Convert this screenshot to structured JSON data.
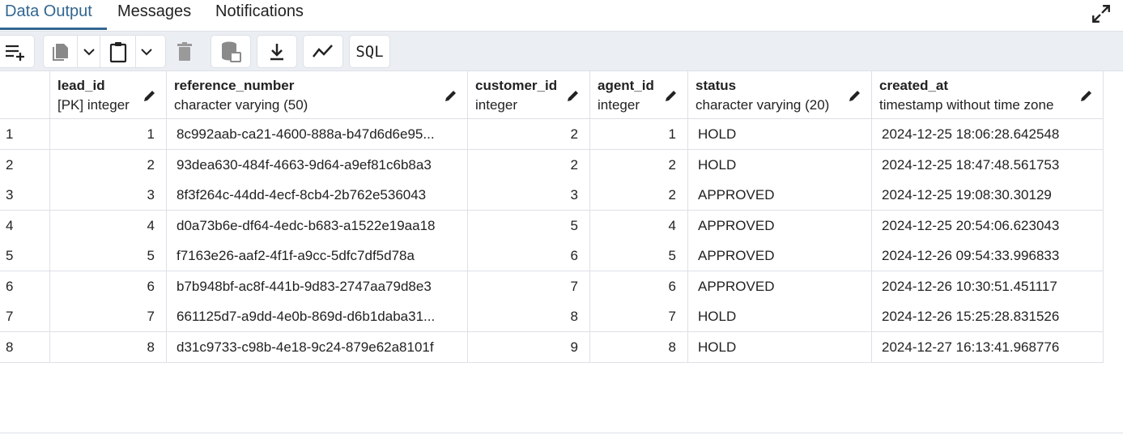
{
  "tabs": [
    {
      "label": "Data Output",
      "active": true
    },
    {
      "label": "Messages",
      "active": false
    },
    {
      "label": "Notifications",
      "active": false
    }
  ],
  "toolbar": {
    "buttons": [
      {
        "name": "add-row-button",
        "icon": "add-row-icon"
      },
      {
        "name": "copy-button",
        "icon": "copy-icon"
      },
      {
        "name": "copy-options-dropdown",
        "icon": "chevron-down-icon"
      },
      {
        "name": "paste-button",
        "icon": "paste-icon"
      },
      {
        "name": "paste-options-dropdown",
        "icon": "chevron-down-icon"
      },
      {
        "name": "delete-button",
        "icon": "trash-icon"
      },
      {
        "name": "save-data-button",
        "icon": "database-save-icon"
      },
      {
        "name": "download-button",
        "icon": "download-icon"
      },
      {
        "name": "graph-visualiser-button",
        "icon": "line-chart-icon"
      },
      {
        "name": "sql-button",
        "icon": "sql-icon"
      }
    ],
    "sql_label": "SQL"
  },
  "columns": [
    {
      "name": "lead_id",
      "type": "[PK] integer"
    },
    {
      "name": "reference_number",
      "type": "character varying (50)"
    },
    {
      "name": "customer_id",
      "type": "integer"
    },
    {
      "name": "agent_id",
      "type": "integer"
    },
    {
      "name": "status",
      "type": "character varying (20)"
    },
    {
      "name": "created_at",
      "type": "timestamp without time zone"
    }
  ],
  "rows": [
    {
      "n": "1",
      "lead_id": "1",
      "reference_number": "8c992aab-ca21-4600-888a-b47d6d6e95...",
      "customer_id": "2",
      "agent_id": "1",
      "status": "HOLD",
      "created_at": "2024-12-25 18:06:28.642548"
    },
    {
      "n": "2",
      "lead_id": "2",
      "reference_number": "93dea630-484f-4663-9d64-a9ef81c6b8a3",
      "customer_id": "2",
      "agent_id": "2",
      "status": "HOLD",
      "created_at": "2024-12-25 18:47:48.561753"
    },
    {
      "n": "3",
      "lead_id": "3",
      "reference_number": "8f3f264c-44dd-4ecf-8cb4-2b762e536043",
      "customer_id": "3",
      "agent_id": "2",
      "status": "APPROVED",
      "created_at": "2024-12-25 19:08:30.30129"
    },
    {
      "n": "4",
      "lead_id": "4",
      "reference_number": "d0a73b6e-df64-4edc-b683-a1522e19aa18",
      "customer_id": "5",
      "agent_id": "4",
      "status": "APPROVED",
      "created_at": "2024-12-25 20:54:06.623043"
    },
    {
      "n": "5",
      "lead_id": "5",
      "reference_number": "f7163e26-aaf2-4f1f-a9cc-5dfc7df5d78a",
      "customer_id": "6",
      "agent_id": "5",
      "status": "APPROVED",
      "created_at": "2024-12-26 09:54:33.996833"
    },
    {
      "n": "6",
      "lead_id": "6",
      "reference_number": "b7b948bf-ac8f-441b-9d83-2747aa79d8e3",
      "customer_id": "7",
      "agent_id": "6",
      "status": "APPROVED",
      "created_at": "2024-12-26 10:30:51.451117"
    },
    {
      "n": "7",
      "lead_id": "7",
      "reference_number": "661125d7-a9dd-4e0b-869d-d6b1daba31...",
      "customer_id": "8",
      "agent_id": "7",
      "status": "HOLD",
      "created_at": "2024-12-26 15:25:28.831526"
    },
    {
      "n": "8",
      "lead_id": "8",
      "reference_number": "d31c9733-c98b-4e18-9c24-879e62a8101f",
      "customer_id": "9",
      "agent_id": "8",
      "status": "HOLD",
      "created_at": "2024-12-27 16:13:41.968776"
    }
  ],
  "colors": {
    "accent": "#326690",
    "toolbar_bg": "#ebeef3",
    "border": "#dde0e6"
  }
}
